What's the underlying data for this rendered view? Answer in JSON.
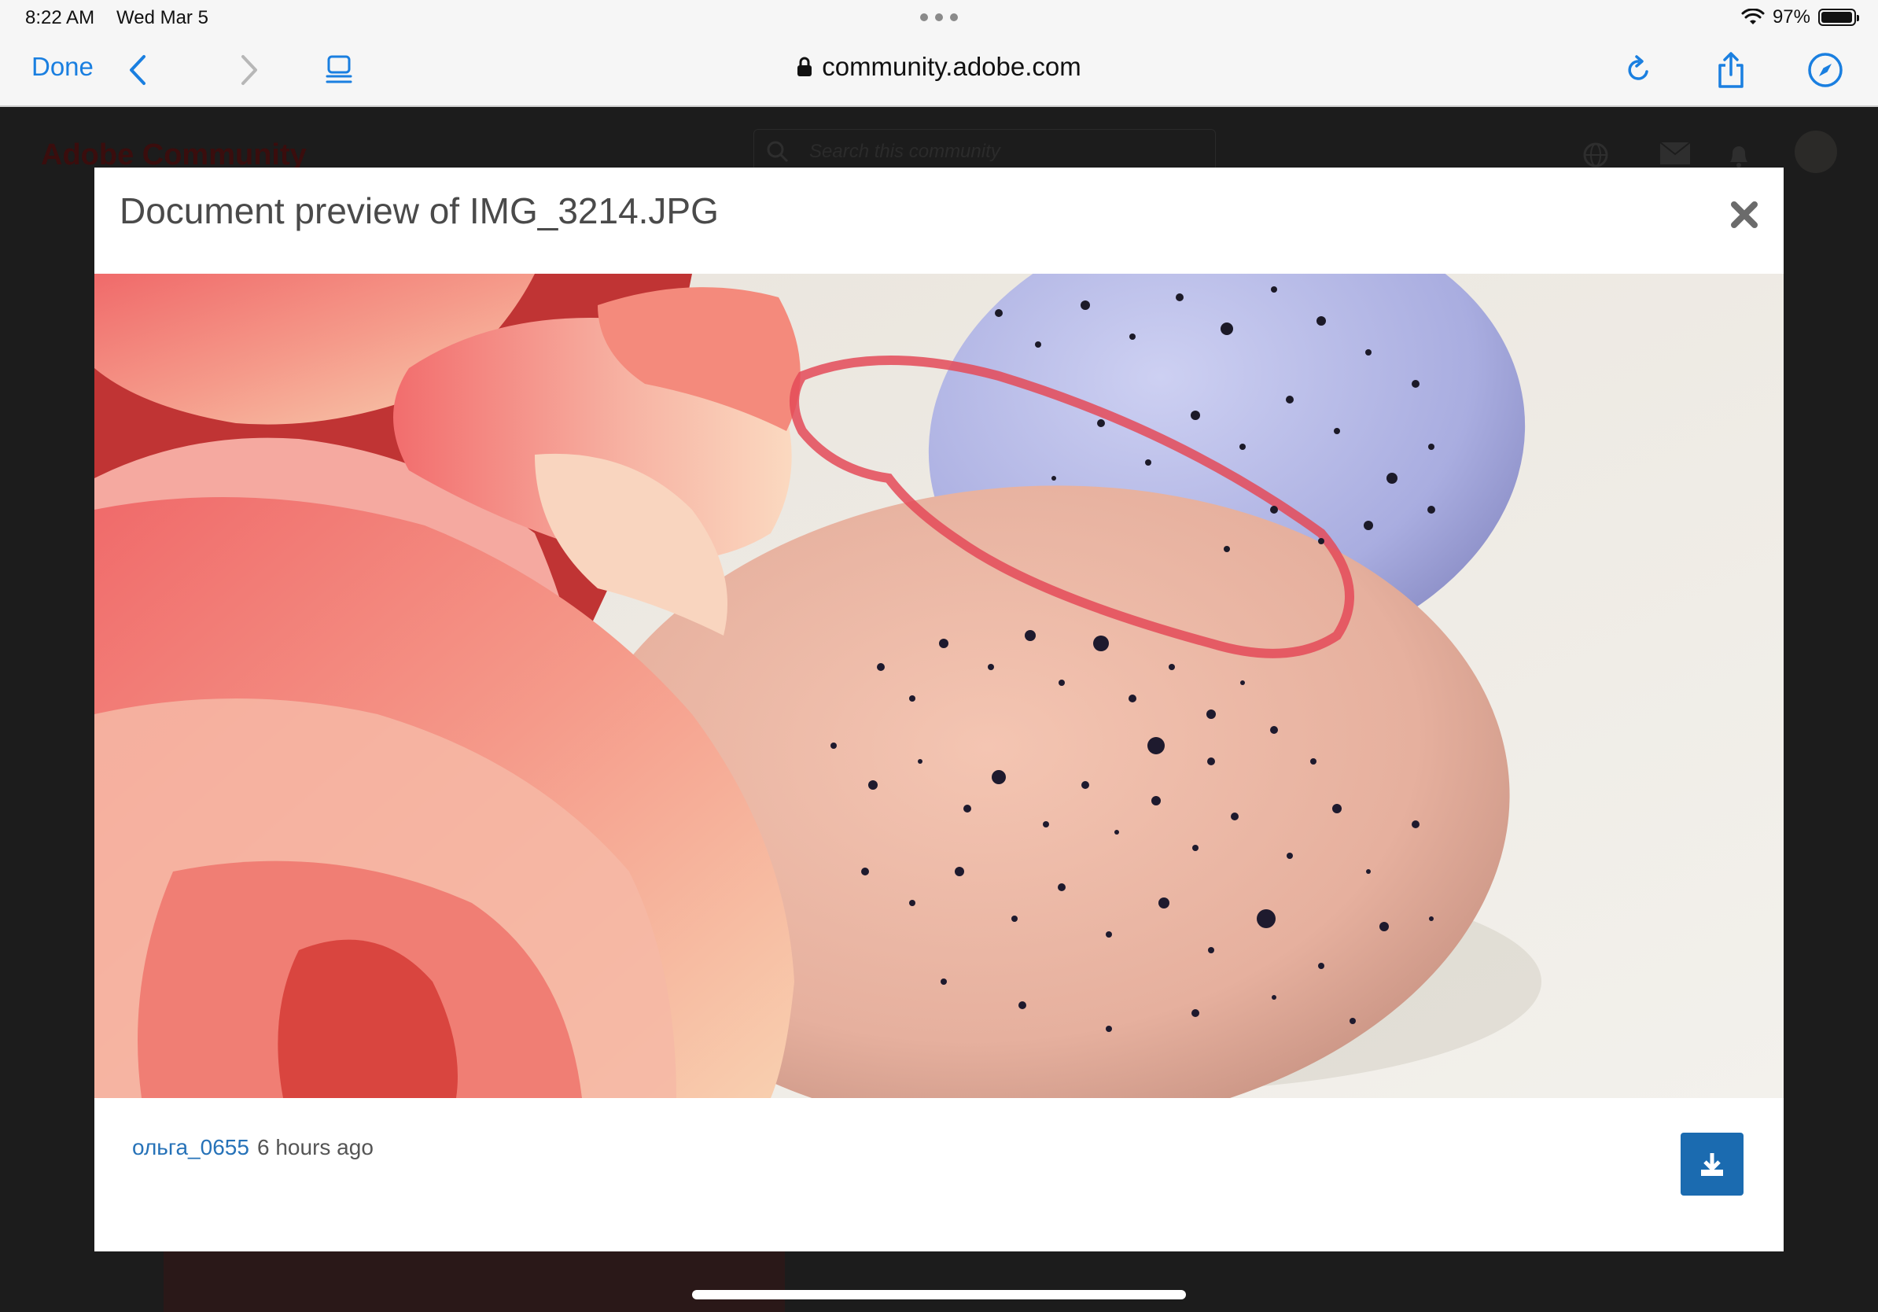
{
  "status_bar": {
    "time": "8:22 AM",
    "date": "Wed Mar 5",
    "battery": "97%",
    "battery_level": 0.97
  },
  "toolbar": {
    "done_label": "Done",
    "url": "community.adobe.com",
    "icons": [
      "back-icon",
      "forward-icon",
      "reader-icon",
      "lock-icon",
      "reload-icon",
      "share-icon",
      "compass-icon"
    ],
    "accent_color": "#1a7fe0"
  },
  "background_page": {
    "brand": "Adobe Community",
    "search_placeholder": "Search this community"
  },
  "modal": {
    "title": "Document preview of IMG_3214.JPG",
    "user": "ольга_0655",
    "time": "6 hours ago",
    "download_color": "#1b6bb0"
  }
}
